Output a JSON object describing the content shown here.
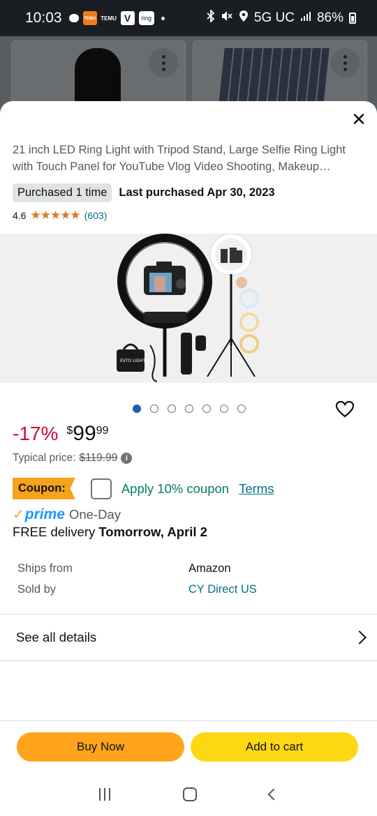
{
  "status_bar": {
    "time": "10:03",
    "temu_label": "TEMU",
    "temu_text": "TEMU",
    "ring_label": "ring",
    "v_label": "V",
    "network": "5G UC",
    "battery": "86%"
  },
  "product": {
    "title": "21 inch LED Ring Light with Tripod Stand, Large Selfie Ring Light with Touch Panel for YouTube Vlog Video Shooting, Makeup…",
    "purchased_badge": "Purchased 1 time",
    "last_purchased": "Last purchased Apr 30, 2023",
    "rating": "4.6",
    "rating_stars": 4.6,
    "stars_text": "★★★★★",
    "rating_count": "(603)",
    "image_count": 7,
    "active_image": 0,
    "image_box_label": "EVTO LIGHT"
  },
  "pricing": {
    "discount": "-17%",
    "currency": "$",
    "price_whole": "99",
    "price_cents": "99",
    "typical_label": "Typical price:",
    "typical_price": "$119.99",
    "info_icon": "i"
  },
  "coupon": {
    "tag": "Coupon:",
    "apply_label": "Apply 10% coupon",
    "terms_label": "Terms"
  },
  "delivery": {
    "prime_check": "✓",
    "prime_word": "prime",
    "speed": "One-Day",
    "free_label": "FREE delivery",
    "date": "Tomorrow, April 2"
  },
  "seller_info": {
    "ships_from_label": "Ships from",
    "ships_from_value": "Amazon",
    "sold_by_label": "Sold by",
    "sold_by_value": "CY Direct US"
  },
  "see_all_details": "See all details",
  "buttons": {
    "buy_now": "Buy Now",
    "add_to_cart": "Add to cart",
    "close": "✕"
  },
  "colors": {
    "buy_now": "#ffa41c",
    "add_to_cart": "#ffd814",
    "discount": "#cc0c39",
    "link": "#007185",
    "coupon_green": "#067d62",
    "star": "#de7921"
  },
  "icons": {
    "close": "close-icon",
    "heart": "heart-icon",
    "chevron": "chevron-right-icon",
    "info": "info-icon"
  }
}
